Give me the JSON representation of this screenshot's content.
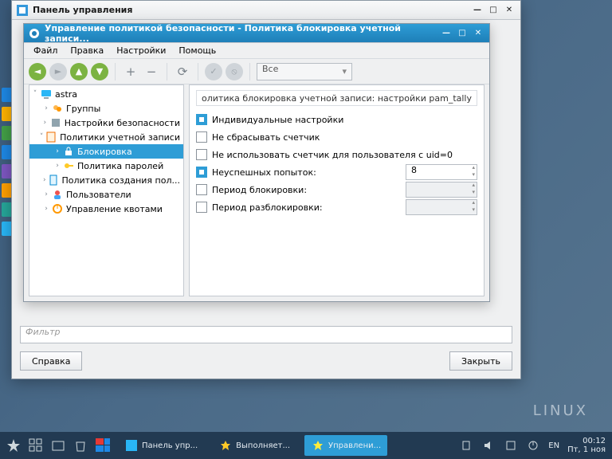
{
  "outer_window": {
    "title": "Панель управления",
    "filter_placeholder": "Фильтр",
    "help_btn": "Справка",
    "close_btn": "Закрыть"
  },
  "inner_window": {
    "title": "Управление политикой безопасности - Политика блокировка учетной записи...",
    "menubar": [
      "Файл",
      "Правка",
      "Настройки",
      "Помощь"
    ],
    "filter_select": "Все"
  },
  "tree": {
    "root": "astra",
    "items": [
      "Группы",
      "Настройки безопасности",
      "Политики учетной записи",
      "Блокировка",
      "Политика паролей",
      "Политика создания пол...",
      "Пользователи",
      "Управление квотами"
    ]
  },
  "content": {
    "header": "олитика блокировка учетной записи: настройки pam_tally",
    "rows": [
      {
        "label": "Индивидуальные настройки",
        "checked": true,
        "has_spin": false
      },
      {
        "label": "Не сбрасывать счетчик",
        "checked": false,
        "has_spin": false
      },
      {
        "label": "Не использовать счетчик для пользователя с uid=0",
        "checked": false,
        "has_spin": false
      },
      {
        "label": "Неуспешных попыток:",
        "checked": true,
        "has_spin": true,
        "value": "8",
        "enabled": true
      },
      {
        "label": "Период блокировки:",
        "checked": false,
        "has_spin": true,
        "value": "",
        "enabled": false
      },
      {
        "label": "Период разблокировки:",
        "checked": false,
        "has_spin": true,
        "value": "",
        "enabled": false
      }
    ]
  },
  "taskbar": {
    "tasks": [
      "Панель упр...",
      "Выполняет...",
      "Управлени..."
    ],
    "lang": "EN",
    "time": "00:12",
    "date": "Пт, 1 ноя"
  },
  "desktop": {
    "logo": "LINUX"
  }
}
